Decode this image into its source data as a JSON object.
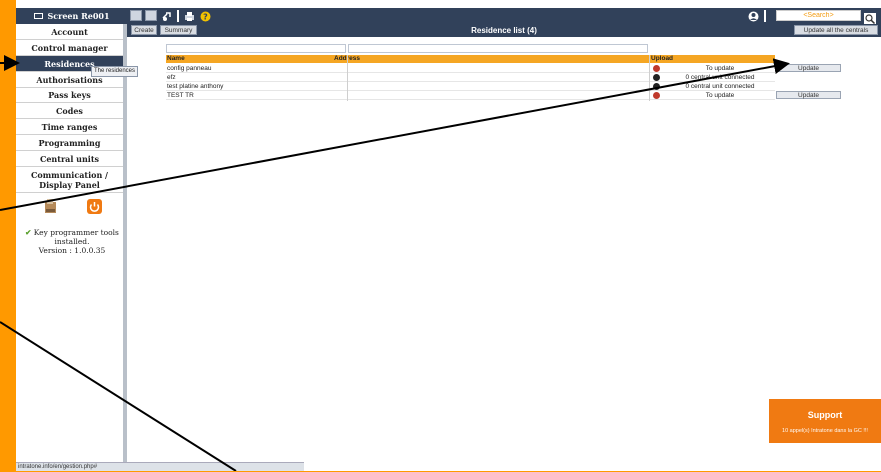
{
  "topbar": {
    "screen_label": "Screen Re001",
    "search_placeholder": "<Search>"
  },
  "sidebar": {
    "items": [
      {
        "label": "Account"
      },
      {
        "label": "Control manager"
      },
      {
        "label": "Residences"
      },
      {
        "label": "Authorisations"
      },
      {
        "label": "Pass keys"
      },
      {
        "label": "Codes"
      },
      {
        "label": "Time ranges"
      },
      {
        "label": "Programming"
      },
      {
        "label": "Central units"
      },
      {
        "label": "Communication / Display Panel"
      }
    ],
    "tooltip": "The residences",
    "tools_status": "Key programmer tools installed.",
    "version": "Version : 1.0.0.35"
  },
  "toolbar": {
    "create_label": "Create",
    "summary_label": "Summary",
    "title": "Residence list (4)",
    "update_all_label": "Update all the centrals"
  },
  "table": {
    "columns": {
      "name": "Name",
      "address": "Address",
      "upload": "Upload"
    },
    "rows": [
      {
        "name": "config panneau",
        "address": "",
        "status": "red",
        "upload_text": "To update",
        "button": "Update"
      },
      {
        "name": "efz",
        "address": "",
        "status": "black",
        "upload_text": "0 central unit connected",
        "button": ""
      },
      {
        "name": "test platine anthony",
        "address": "",
        "status": "black",
        "upload_text": "0 central unit connected",
        "button": ""
      },
      {
        "name": "TEST TR",
        "address": "",
        "status": "red",
        "upload_text": "To update",
        "button": "Update"
      }
    ]
  },
  "support": {
    "title": "Support",
    "subtitle": "10 appel(s) Intratone dans la GC !!!"
  },
  "status_bar": "intratone.info/en/gestion.php#",
  "colors": {
    "frame_orange": "#ff9900",
    "nav_dark": "#31415a",
    "header_orange": "#f5a623",
    "support_orange": "#f07a12",
    "status_red": "#c0392b"
  }
}
